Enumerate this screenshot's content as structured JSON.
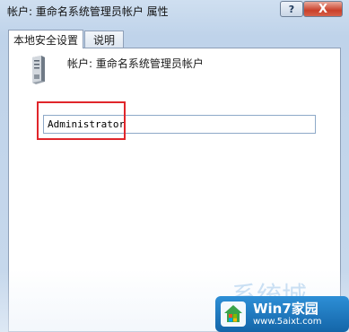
{
  "window": {
    "title": "帐户: 重命名系统管理员帐户 属性",
    "help_label": "?",
    "close_label": "X"
  },
  "tabs": [
    {
      "label": "本地安全设置"
    },
    {
      "label": "说明"
    }
  ],
  "panel": {
    "account_label": "帐户: 重命名系统管理员帐户",
    "input_value": "Administrator",
    "icon": "server-tower-icon",
    "highlight_color": "#e0262b"
  },
  "watermark": {
    "bg_text": "系统城",
    "title": "Win7家园",
    "url": "www.5aixt.com"
  }
}
